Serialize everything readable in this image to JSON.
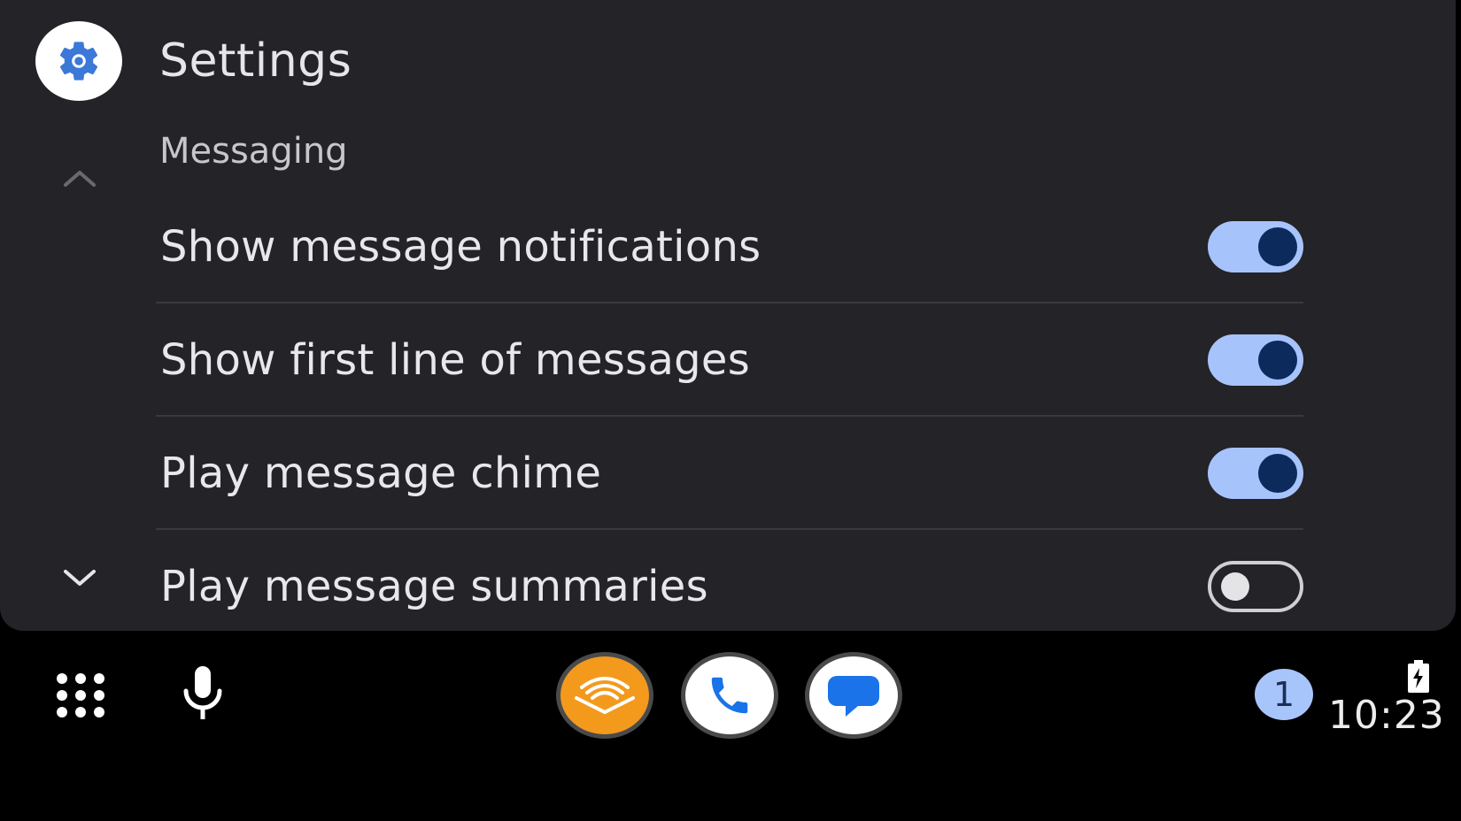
{
  "header": {
    "title": "Settings",
    "app_icon": "settings-gear-icon"
  },
  "section": {
    "title": "Messaging"
  },
  "scroll": {
    "up_icon": "chevron-up-icon",
    "down_icon": "chevron-down-icon"
  },
  "settings": [
    {
      "label": "Show message notifications",
      "enabled": true
    },
    {
      "label": "Show first line of messages",
      "enabled": true
    },
    {
      "label": "Play message chime",
      "enabled": true
    },
    {
      "label": "Play message summaries",
      "enabled": false
    }
  ],
  "dock": {
    "launcher_icon": "app-grid-icon",
    "voice_icon": "microphone-icon",
    "apps": [
      {
        "name": "audible-icon",
        "color": "#f39a1d"
      },
      {
        "name": "phone-icon",
        "color": "#1a73e8"
      },
      {
        "name": "messages-icon",
        "color": "#1a73e8"
      }
    ]
  },
  "status": {
    "notification_count": "1",
    "time": "10:23",
    "battery_icon": "battery-charging-icon"
  },
  "colors": {
    "accent": "#a7c3fb",
    "toggle_knob_on": "#0d2a5c",
    "panel_bg": "#242327",
    "screen_bg": "#000000"
  }
}
